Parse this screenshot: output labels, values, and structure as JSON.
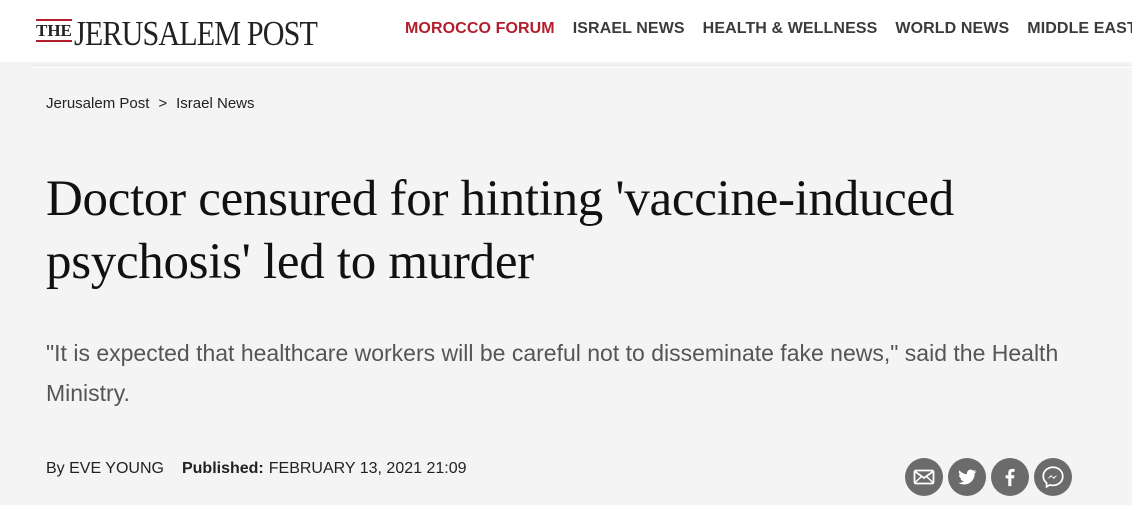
{
  "header": {
    "logo_the": "THE",
    "logo_main": "JERUSALEM POST",
    "nav": [
      {
        "label": "MOROCCO FORUM",
        "active": true
      },
      {
        "label": "ISRAEL NEWS",
        "active": false
      },
      {
        "label": "HEALTH & WELLNESS",
        "active": false
      },
      {
        "label": "WORLD NEWS",
        "active": false
      },
      {
        "label": "MIDDLE EAST",
        "active": false
      }
    ]
  },
  "breadcrumb": {
    "home": "Jerusalem Post",
    "separator": ">",
    "section": "Israel News"
  },
  "article": {
    "headline": "Doctor censured for hinting 'vaccine-induced psychosis' led to murder",
    "subtitle": "\"It is expected that healthcare workers will be careful not to disseminate fake news,\" said the Health Ministry.",
    "byline": "By EVE YOUNG",
    "published_label": "Published:",
    "published_date": "FEBRUARY 13, 2021 21:09"
  },
  "share": {
    "icons": [
      "email-icon",
      "twitter-icon",
      "facebook-icon",
      "messenger-icon"
    ]
  },
  "colors": {
    "accent": "#b31e2c",
    "background": "#f4f4f4",
    "share_icon_bg": "#6b6b6b"
  }
}
